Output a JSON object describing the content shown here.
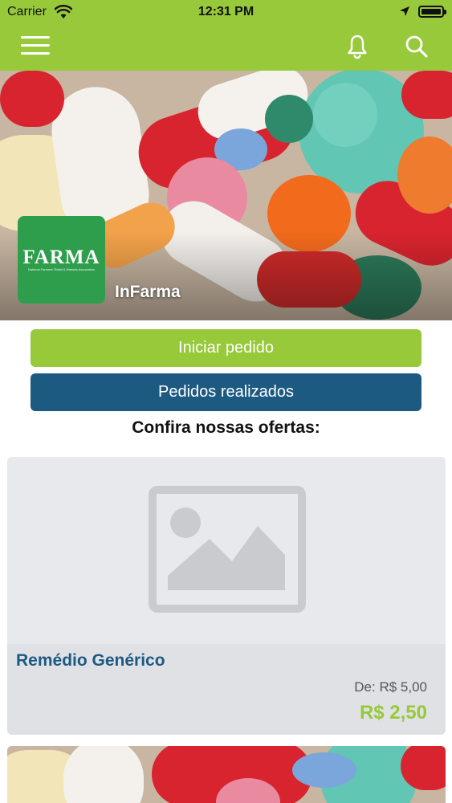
{
  "status_bar": {
    "carrier": "Carrier",
    "time": "12:31 PM",
    "icons": [
      "wifi-icon",
      "location-arrow-icon",
      "battery-icon"
    ]
  },
  "nav": {
    "icons": [
      "hamburger-menu-icon",
      "bell-icon",
      "search-icon"
    ]
  },
  "hero": {
    "logo_text": "FARMA",
    "logo_subtext": "National Farmers' Retail & Markets Association",
    "store_name": "InFarma"
  },
  "actions": {
    "start_order": "Iniciar pedido",
    "orders_placed": "Pedidos realizados"
  },
  "offers": {
    "title": "Confira nossas ofertas:",
    "products": [
      {
        "name": "Remédio Genérico",
        "old_price": "De: R$ 5,00",
        "price": "R$ 2,50"
      }
    ]
  },
  "colors": {
    "brand_green": "#97c93a",
    "brand_blue": "#1d5a82",
    "logo_green": "#2f9e4c"
  }
}
